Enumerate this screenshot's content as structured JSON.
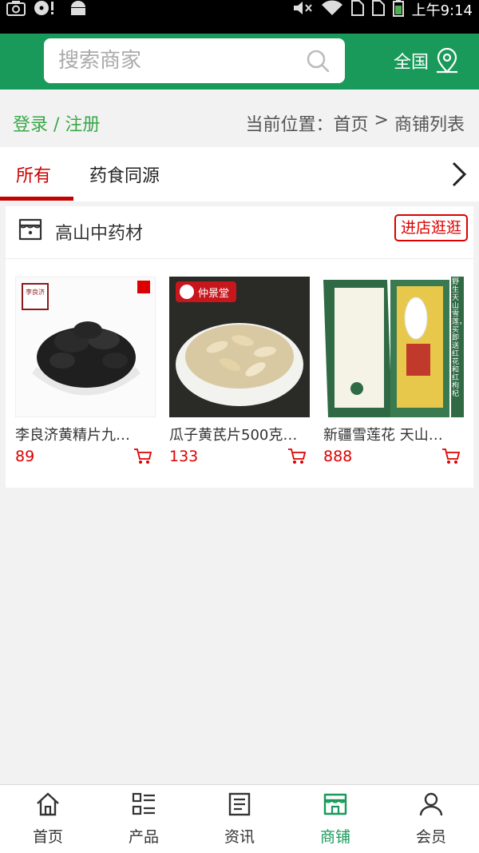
{
  "status_bar": {
    "time": "上午9:14"
  },
  "header": {
    "search_placeholder": "搜索商家",
    "region_label": "全国",
    "colors": {
      "brand": "#1a9a5a"
    }
  },
  "location_bar": {
    "login_label": "登录 / 注册",
    "breadcrumb_prefix": "当前位置：",
    "breadcrumb_home": "首页",
    "breadcrumb_sep": " > ",
    "breadcrumb_current": "商铺列表"
  },
  "tabs": [
    {
      "label": "所有"
    },
    {
      "label": "药食同源"
    }
  ],
  "shop": {
    "name": "高山中药材",
    "enter_label": "进店逛逛",
    "products": [
      {
        "title": "李良济黄精片九…",
        "price": "89",
        "brand_text": "李良济"
      },
      {
        "title": "瓜子黄芪片500克…",
        "price": "133",
        "brand_text": "仲景堂"
      },
      {
        "title": "新疆雪莲花 天山…",
        "price": "888",
        "side_text": "野生天山雪莲，买即送红花和红枸杞"
      }
    ]
  },
  "bottom_nav": [
    {
      "label": "首页",
      "icon": "home-icon"
    },
    {
      "label": "产品",
      "icon": "grid-list-icon"
    },
    {
      "label": "资讯",
      "icon": "news-icon"
    },
    {
      "label": "商铺",
      "icon": "store-icon"
    },
    {
      "label": "会员",
      "icon": "user-icon"
    }
  ]
}
